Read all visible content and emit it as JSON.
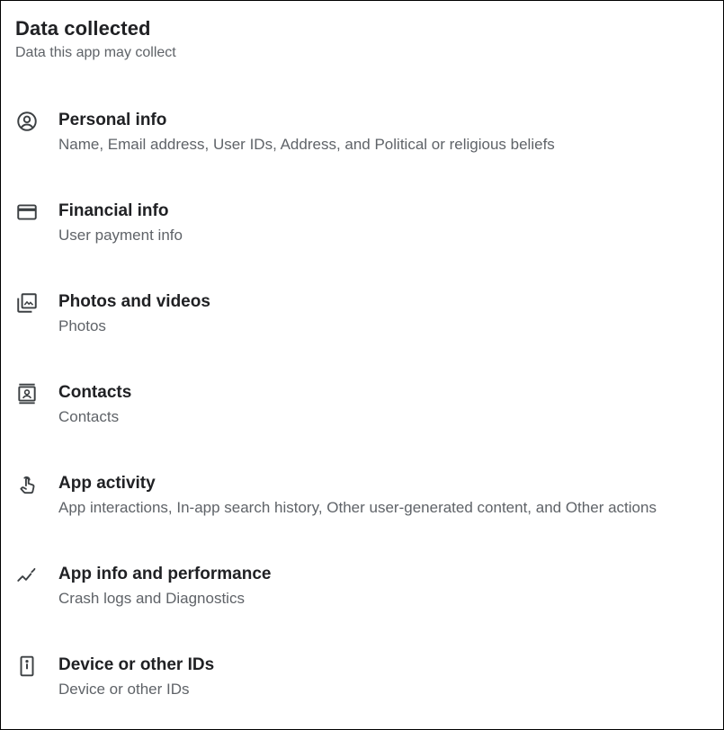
{
  "header": {
    "title": "Data collected",
    "subtitle": "Data this app may collect"
  },
  "items": [
    {
      "icon": "account-circle-icon",
      "label": "Personal info",
      "desc": "Name, Email address, User IDs, Address, and Political or religious beliefs"
    },
    {
      "icon": "credit-card-icon",
      "label": "Financial info",
      "desc": "User payment info"
    },
    {
      "icon": "photo-library-icon",
      "label": "Photos and videos",
      "desc": "Photos"
    },
    {
      "icon": "contacts-icon",
      "label": "Contacts",
      "desc": "Contacts"
    },
    {
      "icon": "touch-app-icon",
      "label": "App activity",
      "desc": "App interactions, In-app search history, Other user-generated content, and Other actions"
    },
    {
      "icon": "trending-icon",
      "label": "App info and performance",
      "desc": "Crash logs and Diagnostics"
    },
    {
      "icon": "phone-device-icon",
      "label": "Device or other IDs",
      "desc": "Device or other IDs"
    }
  ],
  "colors": {
    "text_primary": "#202124",
    "text_secondary": "#5f6368",
    "border": "#000000"
  }
}
